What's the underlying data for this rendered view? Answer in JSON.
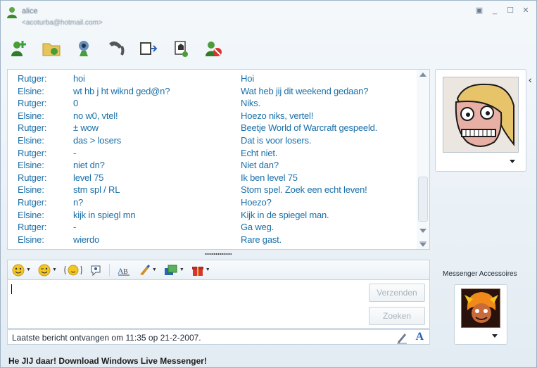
{
  "window": {
    "contact_name": "alice",
    "contact_email": "<acoturba@hotmail.com>",
    "controls": [
      "▣",
      "_",
      "☐",
      "✕"
    ]
  },
  "toolbar": {
    "items": [
      {
        "name": "invite-contact",
        "icon": "add-contact-icon"
      },
      {
        "name": "send-files",
        "icon": "folder-icon"
      },
      {
        "name": "video-call",
        "icon": "webcam-icon"
      },
      {
        "name": "call",
        "icon": "phone-icon"
      },
      {
        "name": "activities",
        "icon": "activities-icon"
      },
      {
        "name": "games",
        "icon": "games-icon"
      },
      {
        "name": "block",
        "icon": "block-contact-icon"
      }
    ]
  },
  "conversation": {
    "messages": [
      {
        "speaker": "Rutger:",
        "short": "hoi",
        "full": "Hoi"
      },
      {
        "speaker": "Elsine:",
        "short": "wt hb j ht wiknd ged@n?",
        "full": "Wat heb jij dit weekend gedaan?"
      },
      {
        "speaker": "Rutger:",
        "short": "0",
        "full": "Niks."
      },
      {
        "speaker": "Elsine:",
        "short": "no w0, vtel!",
        "full": "Hoezo niks, vertel!"
      },
      {
        "speaker": "Rutger:",
        "short": "± wow",
        "full": "Beetje World of Warcraft gespeeld."
      },
      {
        "speaker": "Elsine:",
        "short": "das > losers",
        "full": "Dat is voor losers."
      },
      {
        "speaker": "Rutger:",
        "short": "-",
        "full": "Echt niet."
      },
      {
        "speaker": "Elsine:",
        "short": "niet dn?",
        "full": "Niet dan?"
      },
      {
        "speaker": "Rutger:",
        "short": "level 75",
        "full": "Ik ben level 75"
      },
      {
        "speaker": "Elsine:",
        "short": "stm spl / RL",
        "full": "Stom spel. Zoek een echt leven!"
      },
      {
        "speaker": "Rutger:",
        "short": "n?",
        "full": "Hoezo?"
      },
      {
        "speaker": "Elsine:",
        "short": "kijk in spiegl mn",
        "full": "Kijk in de spiegel man."
      },
      {
        "speaker": "Rutger:",
        "short": "-",
        "full": "Ga weg."
      },
      {
        "speaker": "Elsine:",
        "short": "wierdo",
        "full": "Rare gast."
      }
    ]
  },
  "format_bar": {
    "items": [
      "emoticon-icon",
      "wink-icon",
      "nudge-icon",
      "voice-clip-icon",
      "font-icon",
      "background-icon",
      "ink-icon",
      "gift-icon"
    ]
  },
  "input": {
    "send_label": "Verzenden",
    "search_label": "Zoeken"
  },
  "status": {
    "last_message": "Laatste bericht ontvangen om 11:35 op 21-2-2007."
  },
  "promo": {
    "text": "He JIJ daar! Download Windows Live Messenger!"
  },
  "sidebar": {
    "accessories_label": "Messenger Accessoires"
  },
  "colors": {
    "chat_text": "#1a6fa8",
    "disabled_button_text": "#a9b4bd"
  }
}
